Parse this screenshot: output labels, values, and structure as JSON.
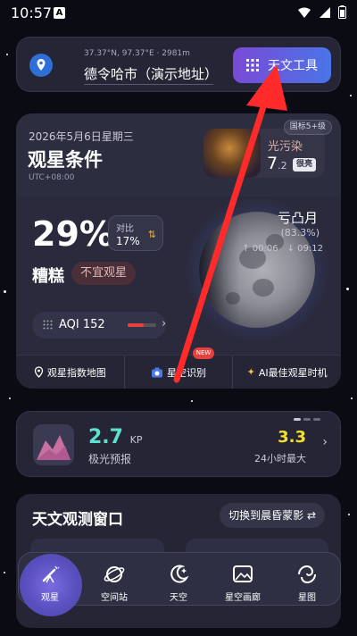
{
  "status": {
    "time": "10:57"
  },
  "location": {
    "coords": "37.37°N, 97.37°E · 2981m",
    "name": "德令哈市（演示地址）",
    "tools_label": "天文工具"
  },
  "observation": {
    "date": "2026年5月6日星期三",
    "title": "观星条件",
    "timezone": "UTC+08:00",
    "grade_badge": "国标5+级",
    "light_pollution_label": "光污染",
    "light_pollution_value": "7",
    "light_pollution_decimal": ".2",
    "light_pollution_tag": "很亮",
    "score": "29%",
    "compare_label": "对比",
    "compare_value": "17%",
    "quality": "糟糕",
    "advice": "不宜观星",
    "aqi": "AQI 152",
    "aqi_level": 0.55,
    "moon_phase": "亏凸月",
    "moon_illumination": "(83.3%)",
    "moonrise": "00:06",
    "moonset": "09:12",
    "actions": [
      {
        "label": "观星指数地图",
        "icon": "map-pin-icon"
      },
      {
        "label": "星空识别",
        "icon": "camera-icon",
        "badge": "NEW"
      },
      {
        "label": "AI最佳观星时机",
        "icon": "sparkle-icon"
      }
    ]
  },
  "aurora": {
    "kp": "2.7",
    "kp_unit": "KP",
    "label": "极光预报",
    "max": "3.3",
    "max_label": "24小时最大"
  },
  "window": {
    "title": "天文观测窗口",
    "switch_label": "切换到晨昏蒙影"
  },
  "nav": [
    {
      "label": "观星",
      "icon": "telescope-icon",
      "active": true
    },
    {
      "label": "空间站",
      "icon": "space-station-icon"
    },
    {
      "label": "天空",
      "icon": "moon-sky-icon"
    },
    {
      "label": "星空画廊",
      "icon": "gallery-icon"
    },
    {
      "label": "星图",
      "icon": "galaxy-icon"
    }
  ],
  "colors": {
    "accent_purple": "#7a4ad6",
    "accent_blue": "#4a74e8",
    "aurora_kp": "#5ce0d0",
    "aurora_max": "#f2e030",
    "aqi_red": "#e84040",
    "annotation_arrow": "#ff2a2a"
  }
}
